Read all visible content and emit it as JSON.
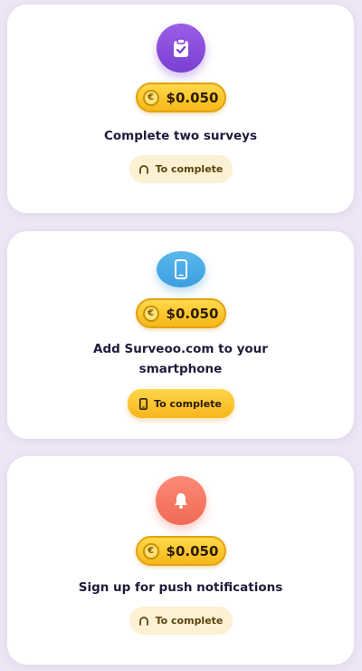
{
  "tasks": [
    {
      "icon": "clipboard-check-icon",
      "reward": "$0.050",
      "title": "Complete two surveys",
      "action_label": "To complete",
      "action_icon": "progress-arc-icon"
    },
    {
      "icon": "smartphone-icon",
      "reward": "$0.050",
      "title_line1": "Add Surveoo.com to your",
      "title_line2": "smartphone",
      "action_label": "To complete",
      "action_icon": "smartphone-icon"
    },
    {
      "icon": "bell-icon",
      "reward": "$0.050",
      "title": "Sign up for push notifications",
      "action_label": "To complete",
      "action_icon": "progress-arc-icon"
    }
  ],
  "coin_symbol": "€",
  "colors": {
    "background": "#ece6f5",
    "purple": "#8a4fdc",
    "blue": "#4aa8e6",
    "orange": "#f47a64",
    "gold": "#f6c02a"
  }
}
